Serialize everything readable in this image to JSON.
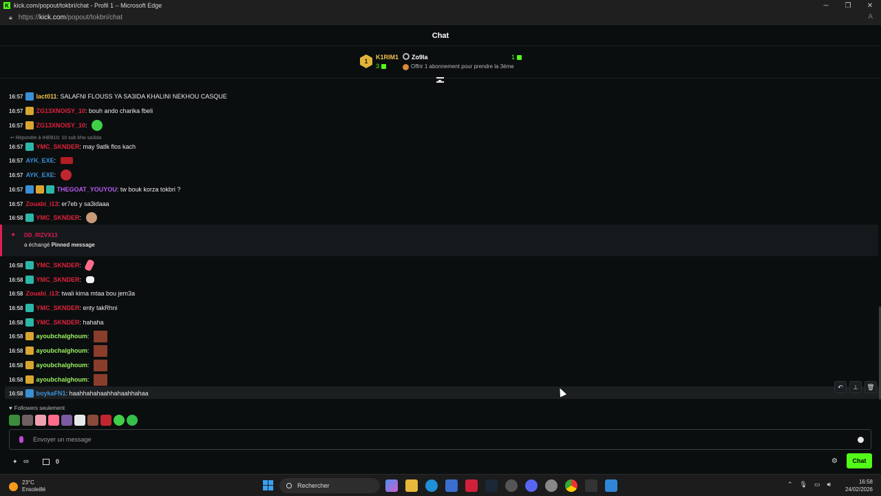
{
  "window": {
    "title": "kick.com/popout/tokbri/chat - Profil 1 – Microsoft Edge",
    "url_prefix": "https://",
    "url_domain": "kick.com",
    "url_path": "/popout/tokbri/chat"
  },
  "chat": {
    "header": "Chat",
    "leaderboard": {
      "first_name": "K1RIM1",
      "first_rank": "1",
      "first_count": "3",
      "second_name": "Zo9la",
      "second_count": "1",
      "offer_text": "Offrir 1 abonnement pour prendre la 3ème"
    },
    "reply_context": "Répondre à IHEB10: 10 sub khw sa3ida",
    "messages": [
      {
        "time": "16:57",
        "badges": [
          "blue"
        ],
        "user": "lact011",
        "user_color": "#f0c24b",
        "text": ": SALAFNI FLOUSS YA SA3IDA KHALINI NEKHOU CASQUE",
        "emote": ""
      },
      {
        "time": "16:57",
        "badges": [
          "gold"
        ],
        "user": "ZG13XNOISY_10",
        "user_color": "#e0223c",
        "text": ": bouh ando charika fbeli",
        "emote": ""
      },
      {
        "time": "16:57",
        "badges": [
          "gold"
        ],
        "user": "ZG13XNOISY_10",
        "user_color": "#e0223c",
        "text": ": ",
        "emote": "green"
      },
      {
        "time": "16:57",
        "badges": [
          "teal"
        ],
        "user": "YMC_SKNDER",
        "user_color": "#e0223c",
        "text": ": may 9atlk flos kach",
        "emote": ""
      },
      {
        "time": "16:57",
        "badges": [],
        "user": "AYK_EXE",
        "user_color": "#3b8fd6",
        "text": ": ",
        "emote": "wuj"
      },
      {
        "time": "16:57",
        "badges": [],
        "user": "AYK_EXE",
        "user_color": "#3b8fd6",
        "text": ": ",
        "emote": "red"
      },
      {
        "time": "16:57",
        "badges": [
          "blue",
          "gold",
          "teal"
        ],
        "user": "THEGOAT_YOUYOU",
        "user_color": "#b65cf0",
        "text": ": tw bouk korza tokbri ?",
        "emote": ""
      },
      {
        "time": "16:57",
        "badges": [],
        "user": "Zouabi_i13",
        "user_color": "#e0223c",
        "text": ": er7eb y sa3idaaa",
        "emote": ""
      },
      {
        "time": "16:58",
        "badges": [
          "teal"
        ],
        "user": "YMC_SKNDER",
        "user_color": "#e0223c",
        "text": ": ",
        "emote": "face"
      },
      {
        "time": "16:58",
        "badges": [
          "teal"
        ],
        "user": "YMC_SKNDER",
        "user_color": "#e0223c",
        "text": ": ",
        "emote": "pink"
      },
      {
        "time": "16:58",
        "badges": [
          "teal"
        ],
        "user": "YMC_SKNDER",
        "user_color": "#e0223c",
        "text": ": ",
        "emote": "white"
      },
      {
        "time": "16:58",
        "badges": [],
        "user": "Zouabi_i13",
        "user_color": "#e0223c",
        "text": ": twali kima mtaa bou jem3a",
        "emote": ""
      },
      {
        "time": "16:58",
        "badges": [
          "teal"
        ],
        "user": "YMC_SKNDER",
        "user_color": "#e0223c",
        "text": ": enty takRhni",
        "emote": ""
      },
      {
        "time": "16:58",
        "badges": [
          "teal"
        ],
        "user": "YMC_SKNDER",
        "user_color": "#e0223c",
        "text": ": hahaha",
        "emote": ""
      },
      {
        "time": "16:58",
        "badges": [
          "gold"
        ],
        "user": "ayoubchalghoum",
        "user_color": "#9cf060",
        "text": ": ",
        "emote": "wall"
      },
      {
        "time": "16:58",
        "badges": [
          "gold"
        ],
        "user": "ayoubchalghoum",
        "user_color": "#9cf060",
        "text": ": ",
        "emote": "wall"
      },
      {
        "time": "16:58",
        "badges": [
          "gold"
        ],
        "user": "ayoubchalghoum",
        "user_color": "#9cf060",
        "text": ": ",
        "emote": "wall"
      },
      {
        "time": "16:58",
        "badges": [
          "gold"
        ],
        "user": "ayoubchalghoum",
        "user_color": "#9cf060",
        "text": ": ",
        "emote": "wall"
      },
      {
        "time": "16:58",
        "badges": [
          "blue"
        ],
        "user": "boykaFN1",
        "user_color": "#3b8fd6",
        "text": ": haahhahahaahhahaahhahaa",
        "emote": ""
      }
    ],
    "pinned": {
      "user": "DD_RIZVX13",
      "text_prefix": "a échangé ",
      "text_bold": "Pinned message"
    },
    "followers_label": "Followers seulement",
    "input_placeholder": "Envoyer un message",
    "store_count": "0",
    "chat_button": "Chat"
  },
  "taskbar": {
    "temperature": "23°C",
    "weather": "Ensoleillé",
    "search_label": "Rechercher",
    "time": "16:58",
    "date": "24/02/2026"
  },
  "colors": {
    "accent": "#53fc18",
    "pinned_accent": "#e01e54",
    "background": "#0b0e0f"
  }
}
